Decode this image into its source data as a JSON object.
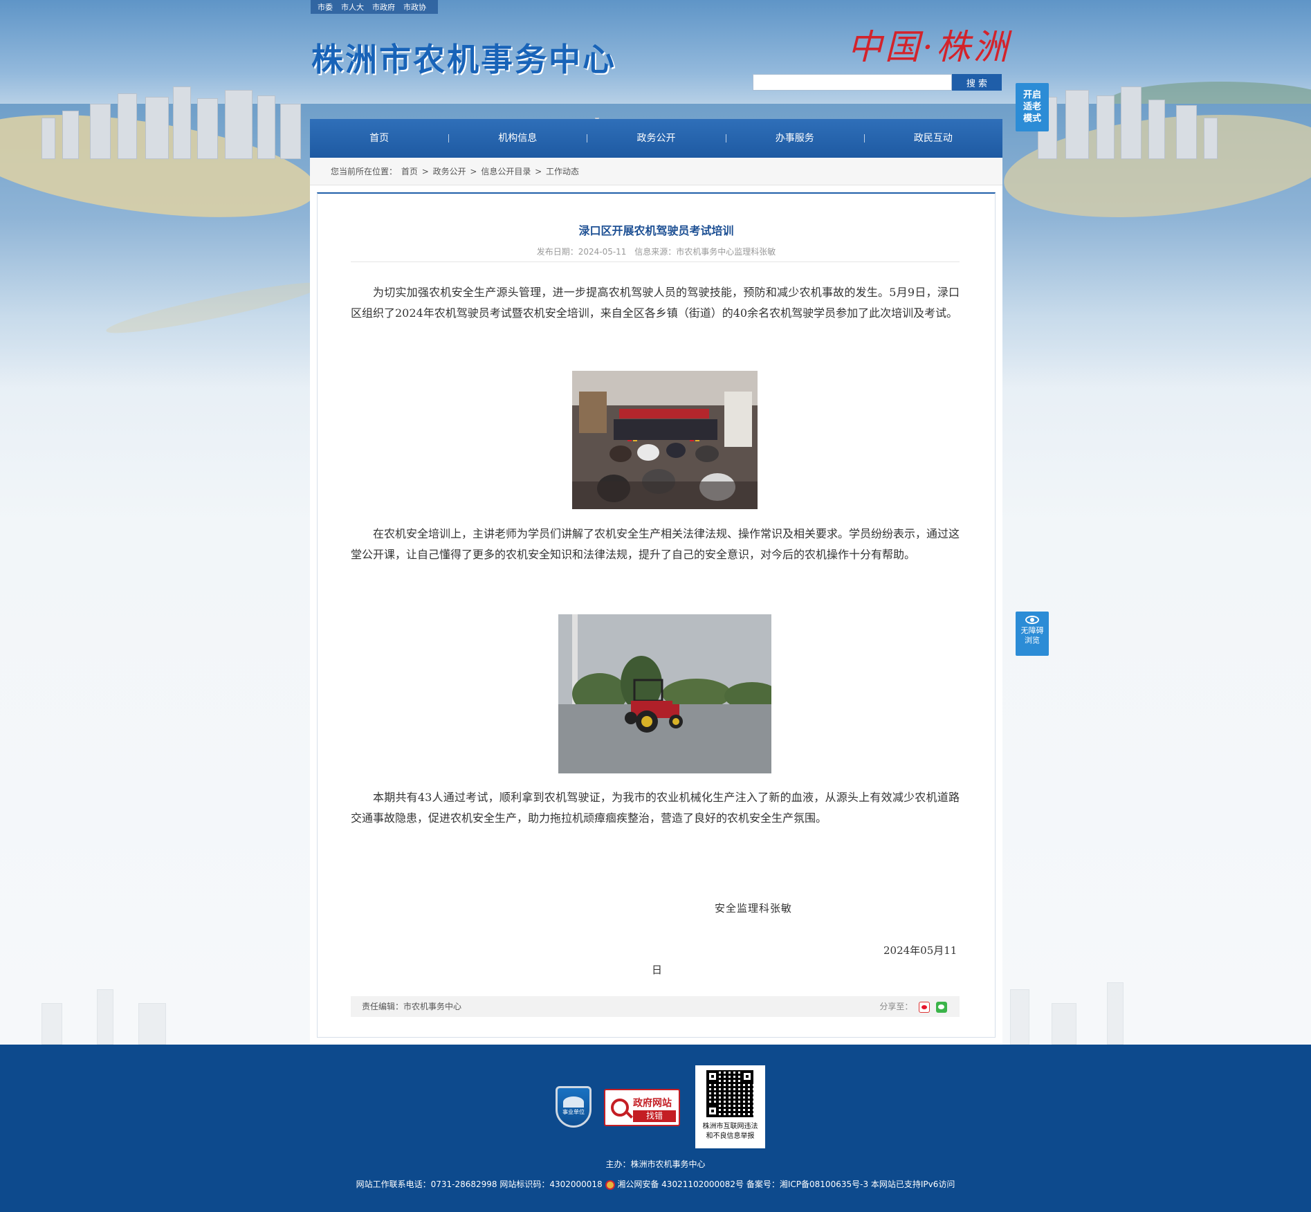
{
  "topbar": {
    "links": [
      "市委",
      "市人大",
      "市政府",
      "市政协"
    ]
  },
  "header": {
    "site_title": "株洲市农机事务中心",
    "logo_text": "中国·株洲",
    "search_placeholder": "",
    "search_button": "搜 索",
    "elder_mode": "开启适老模式",
    "accessibility": "无障碍浏览"
  },
  "nav": {
    "items": [
      "首页",
      "机构信息",
      "政务公开",
      "办事服务",
      "政民互动"
    ]
  },
  "breadcrumb": {
    "prefix": "您当前所在位置：",
    "items": [
      "首页",
      ">",
      "政务公开",
      ">",
      "信息公开目录",
      ">",
      "工作动态"
    ]
  },
  "article": {
    "title": "渌口区开展农机驾驶员考试培训",
    "publish_label": "发布日期：2024-05-11",
    "source_label": "信息来源：市农机事务中心监理科张敏",
    "paragraphs": [
      "为切实加强农机安全生产源头管理，进一步提高农机驾驶人员的驾驶技能，预防和减少农机事故的发生。5月9日，渌口区组织了2024年农机驾驶员考试暨农机安全培训，来自全区各乡镇（街道）的40余名农机驾驶学员参加了此次培训及考试。",
      "在农机安全培训上，主讲老师为学员们讲解了农机安全生产相关法律法规、操作常识及相关要求。学员纷纷表示，通过这堂公开课，让自己懂得了更多的农机安全知识和法律法规，提升了自己的安全意识，对今后的农机操作十分有帮助。",
      "本期共有43人通过考试，顺利拿到农机驾驶证，为我市的农业机械化生产注入了新的血液，从源头上有效减少农机道路交通事故隐患，促进农机安全生产，助力拖拉机顽瘴痼疾整治，营造了良好的农机安全生产氛围。"
    ],
    "signature": "安全监理科张敏",
    "date_line1": "2024年05月11",
    "date_line2": "日",
    "editor": "责任编辑：市农机事务中心",
    "share_label": "分享至："
  },
  "footer": {
    "badge_unit": "事业单位",
    "badge_err_top": "政府网站",
    "badge_err_bottom": "找错",
    "qr_caption_1": "株洲市互联网违法",
    "qr_caption_2": "和不良信息举报",
    "host": "主办：株洲市农机事务中心",
    "contact": "网站工作联系电话：0731-28682998 网站标识码：4302000018",
    "police": "湘公网安备 43021102000082号 备案号：湘ICP备08100635号-3 本网站已支持IPv6访问"
  }
}
